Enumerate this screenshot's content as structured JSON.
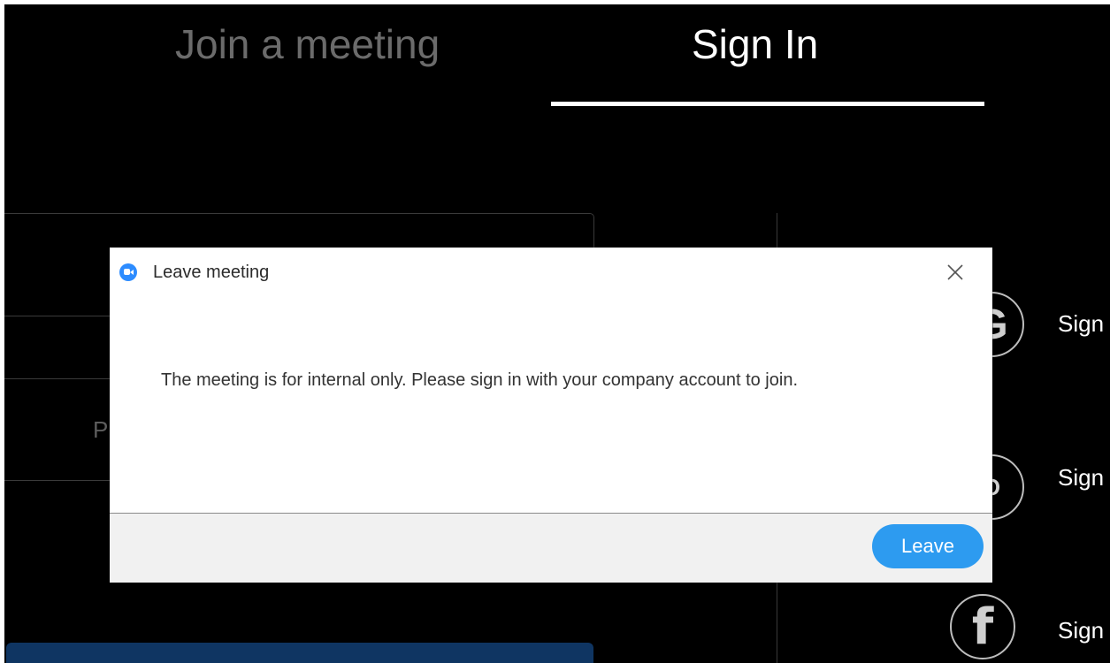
{
  "tabs": {
    "join_label": "Join a meeting",
    "signin_label": "Sign In"
  },
  "background_form": {
    "password_placeholder": "P"
  },
  "sso": {
    "items": [
      {
        "icon": "google-icon",
        "glyph": "G",
        "label": "Sign"
      },
      {
        "icon": "sso-icon",
        "glyph": "O",
        "label": "Sign"
      },
      {
        "icon": "facebook-icon",
        "glyph": "f",
        "label": "Sign"
      }
    ]
  },
  "dialog": {
    "title": "Leave meeting",
    "message": "The meeting is for internal only. Please sign in with your company account to join.",
    "leave_label": "Leave",
    "logo_color": "#2d8cff",
    "button_color": "#2d9bf0"
  }
}
